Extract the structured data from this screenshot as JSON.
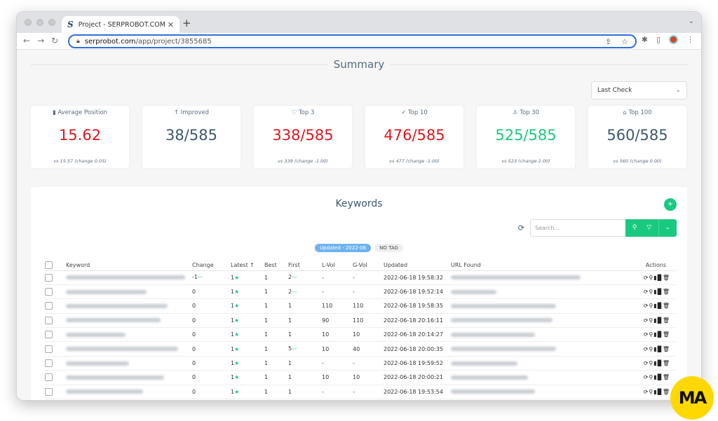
{
  "browser": {
    "tab_title": "Project - SERPROBOT.COM",
    "tab_favicon": "S",
    "url_domain": "serprobot.com",
    "url_path": "/app/project/3855685",
    "icons": [
      "back-icon",
      "forward-icon",
      "reload-icon",
      "lock-icon",
      "share-icon",
      "star-icon",
      "extensions-icon",
      "sidebar-icon",
      "profile-avatar",
      "kebab-menu-icon"
    ]
  },
  "summary": {
    "title": "Summary",
    "period_select": "Last Check",
    "cards": [
      {
        "icon": "bar-chart-icon",
        "glyph": "▮",
        "label": "Average Position",
        "value": "15.62",
        "color": "red",
        "vs": "vs 15.57 (change 0.05)"
      },
      {
        "icon": "arrow-up-icon",
        "glyph": "↑",
        "label": "Improved",
        "value": "38/585",
        "color": "blue",
        "vs": ""
      },
      {
        "icon": "heart-icon",
        "glyph": "♡",
        "label": "Top 3",
        "value": "338/585",
        "color": "red",
        "vs": "vs 339 (change -1.00)"
      },
      {
        "icon": "check-icon",
        "glyph": "✓",
        "label": "Top 10",
        "value": "476/585",
        "color": "red",
        "vs": "vs 477 (change -1.00)"
      },
      {
        "icon": "award-icon",
        "glyph": "♙",
        "label": "Top 30",
        "value": "525/585",
        "color": "green",
        "vs": "vs 523 (change 2.00)"
      },
      {
        "icon": "briefcase-icon",
        "glyph": "⌂",
        "label": "Top 100",
        "value": "560/585",
        "color": "blue",
        "vs": "vs 560 (change 0.00)"
      }
    ]
  },
  "keywords": {
    "title": "Keywords",
    "add_label": "+",
    "search_placeholder": "Search...",
    "tags": [
      "Updated - 2022-06",
      "NO TAG"
    ],
    "columns": [
      "Keyword",
      "Change",
      "Latest ↑",
      "Best",
      "First",
      "L-Vol",
      "G-Vol",
      "Updated",
      "URL Found",
      "Actions"
    ],
    "rows": [
      {
        "change": "-1",
        "change_trend": true,
        "latest": "1",
        "best": "1",
        "first": "2",
        "first_trend": true,
        "lvol": "-",
        "gvol": "-",
        "updated": "2022-06-18 19:58:32",
        "kw_w": 170,
        "url_w": 185
      },
      {
        "change": "0",
        "change_trend": false,
        "latest": "1",
        "best": "1",
        "first": "2",
        "first_trend": true,
        "lvol": "-",
        "gvol": "-",
        "updated": "2022-06-18 19:52:14",
        "kw_w": 115,
        "url_w": 65
      },
      {
        "change": "0",
        "change_trend": false,
        "latest": "1",
        "best": "1",
        "first": "1",
        "first_trend": false,
        "lvol": "110",
        "gvol": "110",
        "updated": "2022-06-18 19:58:35",
        "kw_w": 145,
        "url_w": 150
      },
      {
        "change": "0",
        "change_trend": false,
        "latest": "1",
        "best": "1",
        "first": "1",
        "first_trend": false,
        "lvol": "90",
        "gvol": "110",
        "updated": "2022-06-18 20:16:11",
        "kw_w": 135,
        "url_w": 145
      },
      {
        "change": "0",
        "change_trend": false,
        "latest": "1",
        "best": "1",
        "first": "1",
        "first_trend": false,
        "lvol": "10",
        "gvol": "10",
        "updated": "2022-06-18 20:14:27",
        "kw_w": 85,
        "url_w": 120
      },
      {
        "change": "0",
        "change_trend": false,
        "latest": "1",
        "best": "1",
        "first": "5",
        "first_trend": true,
        "lvol": "10",
        "gvol": "40",
        "updated": "2022-06-18 20:00:35",
        "kw_w": 160,
        "url_w": 150
      },
      {
        "change": "0",
        "change_trend": false,
        "latest": "1",
        "best": "1",
        "first": "1",
        "first_trend": false,
        "lvol": "-",
        "gvol": "-",
        "updated": "2022-06-18 19:59:52",
        "kw_w": 90,
        "url_w": 95
      },
      {
        "change": "0",
        "change_trend": false,
        "latest": "1",
        "best": "1",
        "first": "1",
        "first_trend": false,
        "lvol": "10",
        "gvol": "10",
        "updated": "2022-06-18 20:00:21",
        "kw_w": 140,
        "url_w": 110
      },
      {
        "change": "0",
        "change_trend": false,
        "latest": "1",
        "best": "1",
        "first": "1",
        "first_trend": false,
        "lvol": "-",
        "gvol": "-",
        "updated": "2022-06-18 19:53:54",
        "kw_w": 110,
        "url_w": 120
      }
    ],
    "action_icons": [
      "refresh-icon",
      "search-icon",
      "bar-chart-icon",
      "copy-icon",
      "trash-icon"
    ]
  },
  "watermark": "MA"
}
